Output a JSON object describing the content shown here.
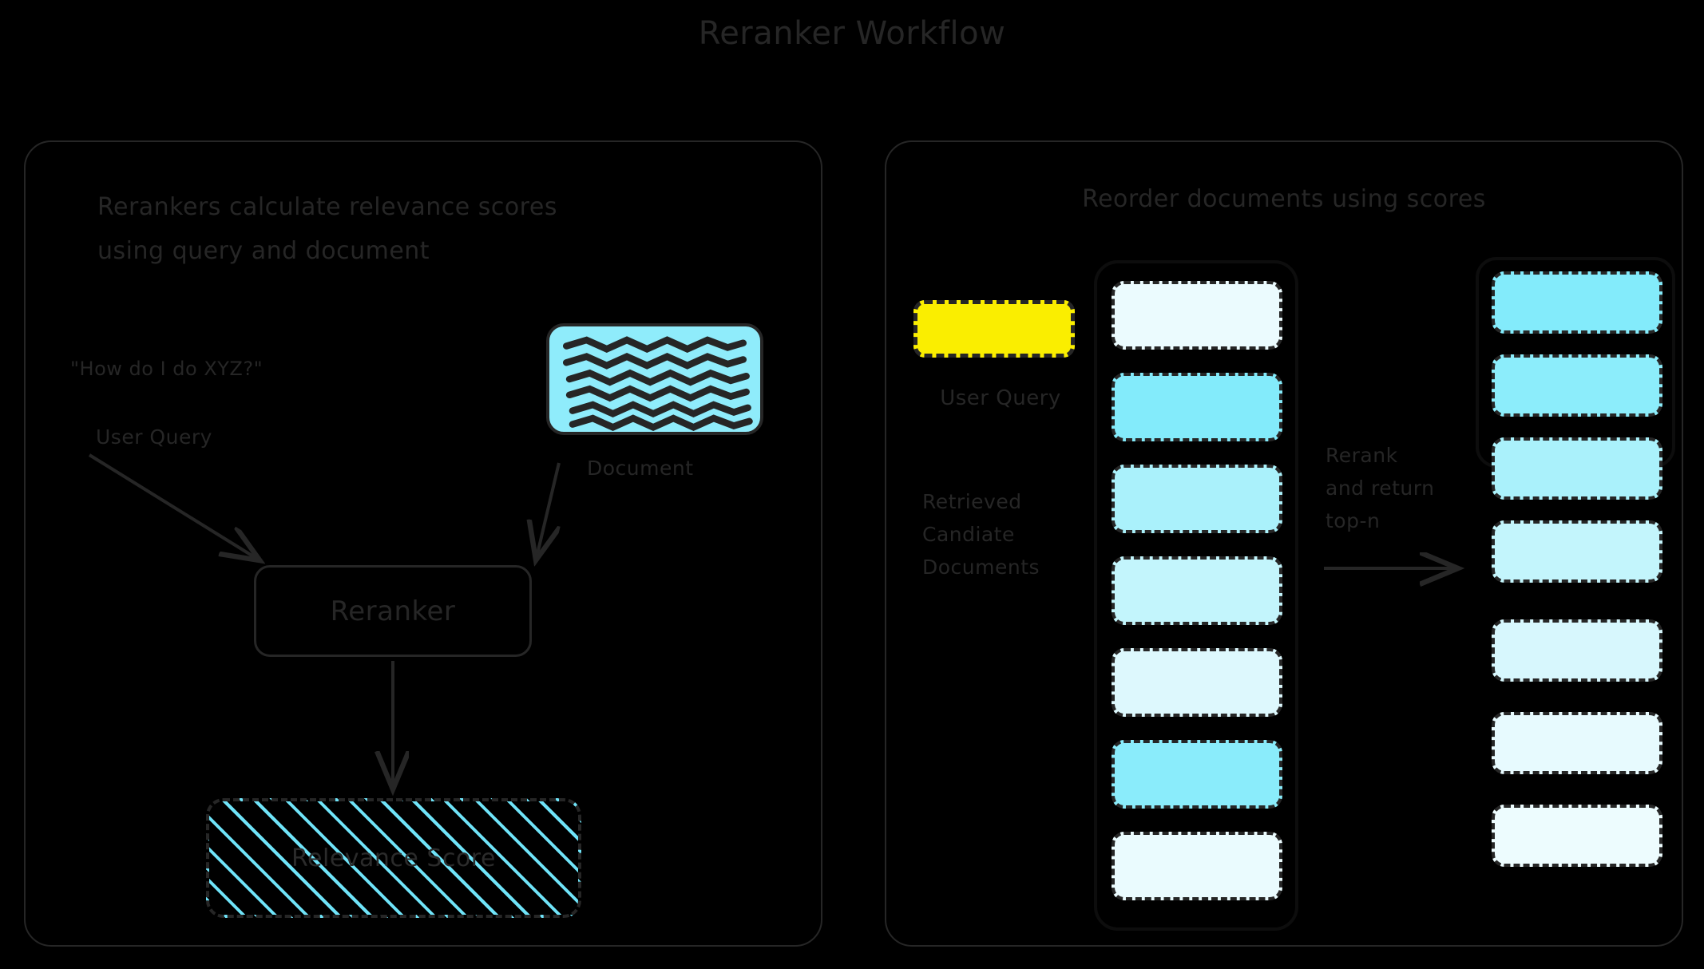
{
  "page": {
    "title": "Reranker Workflow",
    "background_color": "#000000",
    "ink_color": "#262626"
  },
  "panels": {
    "left": {
      "heading": "Rerankers calculate relevance scores\nusing query and document",
      "query_text": "\"How do I do XYZ?\"",
      "query_caption": "User Query",
      "document_caption": "Document",
      "reranker_label": "Reranker",
      "relevance_label": "Relevance Score",
      "document_color": "#8fecfb",
      "hatch_color": "#6fe3f8"
    },
    "right": {
      "heading": "Reorder documents using scores",
      "user_query_caption": "User Query",
      "user_query_color": "#faee00",
      "retrieved_caption": "Retrieved\nCandiate\nDocuments",
      "rerank_caption": "Rerank\nand return\ntop-n"
    }
  },
  "candidate_documents": [
    {
      "index": 1,
      "color": "#ebfbfe",
      "relevance": "very-low"
    },
    {
      "index": 2,
      "color": "#83ebfb",
      "relevance": "very-high"
    },
    {
      "index": 3,
      "color": "#aaf1fb",
      "relevance": "high"
    },
    {
      "index": 4,
      "color": "#c3f5fc",
      "relevance": "medium"
    },
    {
      "index": 5,
      "color": "#ddf8fd",
      "relevance": "low"
    },
    {
      "index": 6,
      "color": "#8aecfb",
      "relevance": "very-high"
    },
    {
      "index": 7,
      "color": "#eafbfe",
      "relevance": "very-low"
    }
  ],
  "reranked_documents": [
    {
      "index": 1,
      "color": "#83ebfb",
      "in_topn": true
    },
    {
      "index": 2,
      "color": "#8cedfb",
      "in_topn": true
    },
    {
      "index": 3,
      "color": "#aaf1fb",
      "in_topn": true
    },
    {
      "index": 4,
      "color": "#c3f5fc",
      "in_topn": true
    },
    {
      "index": 5,
      "color": "#d7f7fd",
      "in_topn": false
    },
    {
      "index": 6,
      "color": "#e7fafe",
      "in_topn": false
    },
    {
      "index": 7,
      "color": "#edfcfe",
      "in_topn": false
    }
  ]
}
